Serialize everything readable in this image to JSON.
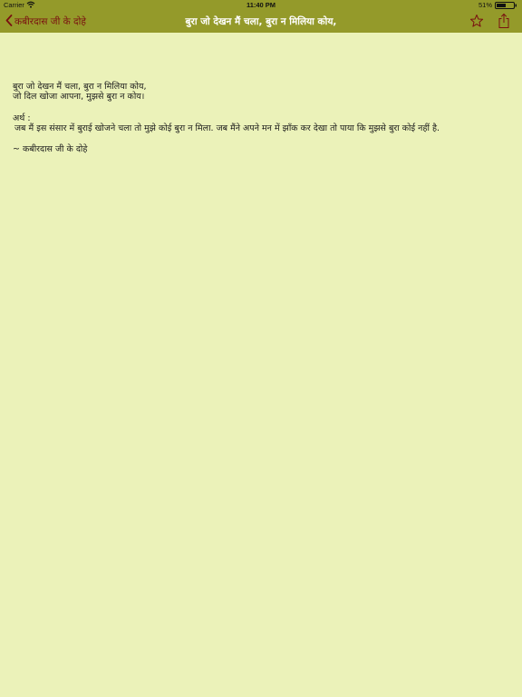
{
  "status_bar": {
    "carrier": "Carrier",
    "time": "11:40 PM",
    "battery": "51%"
  },
  "nav": {
    "back_label": "कबीरदास जी के दोहे",
    "title": "बुरा जो देखन मैं चला, बुरा न मिलिया कोय,",
    "accent_color": "#949a2a",
    "back_color": "#7a1010",
    "icons": [
      "chevron-left-icon",
      "star-icon",
      "share-icon"
    ]
  },
  "doha": {
    "line1": "बुरा जो देखन मैं चला, बुरा न मिलिया कोय,",
    "line2": "जो दिल खोजा आपना, मुझसे बुरा न कोय।",
    "meaning_label": "अर्थ :",
    "meaning": "जब मैं इस संसार में बुराई खोजने चला तो मुझे कोई बुरा न मिला. जब मैंने अपने मन में झाँक कर देखा तो पाया कि मुझसे बुरा कोई नहीं है.",
    "source": "~ कबीरदास जी के दोहे"
  }
}
